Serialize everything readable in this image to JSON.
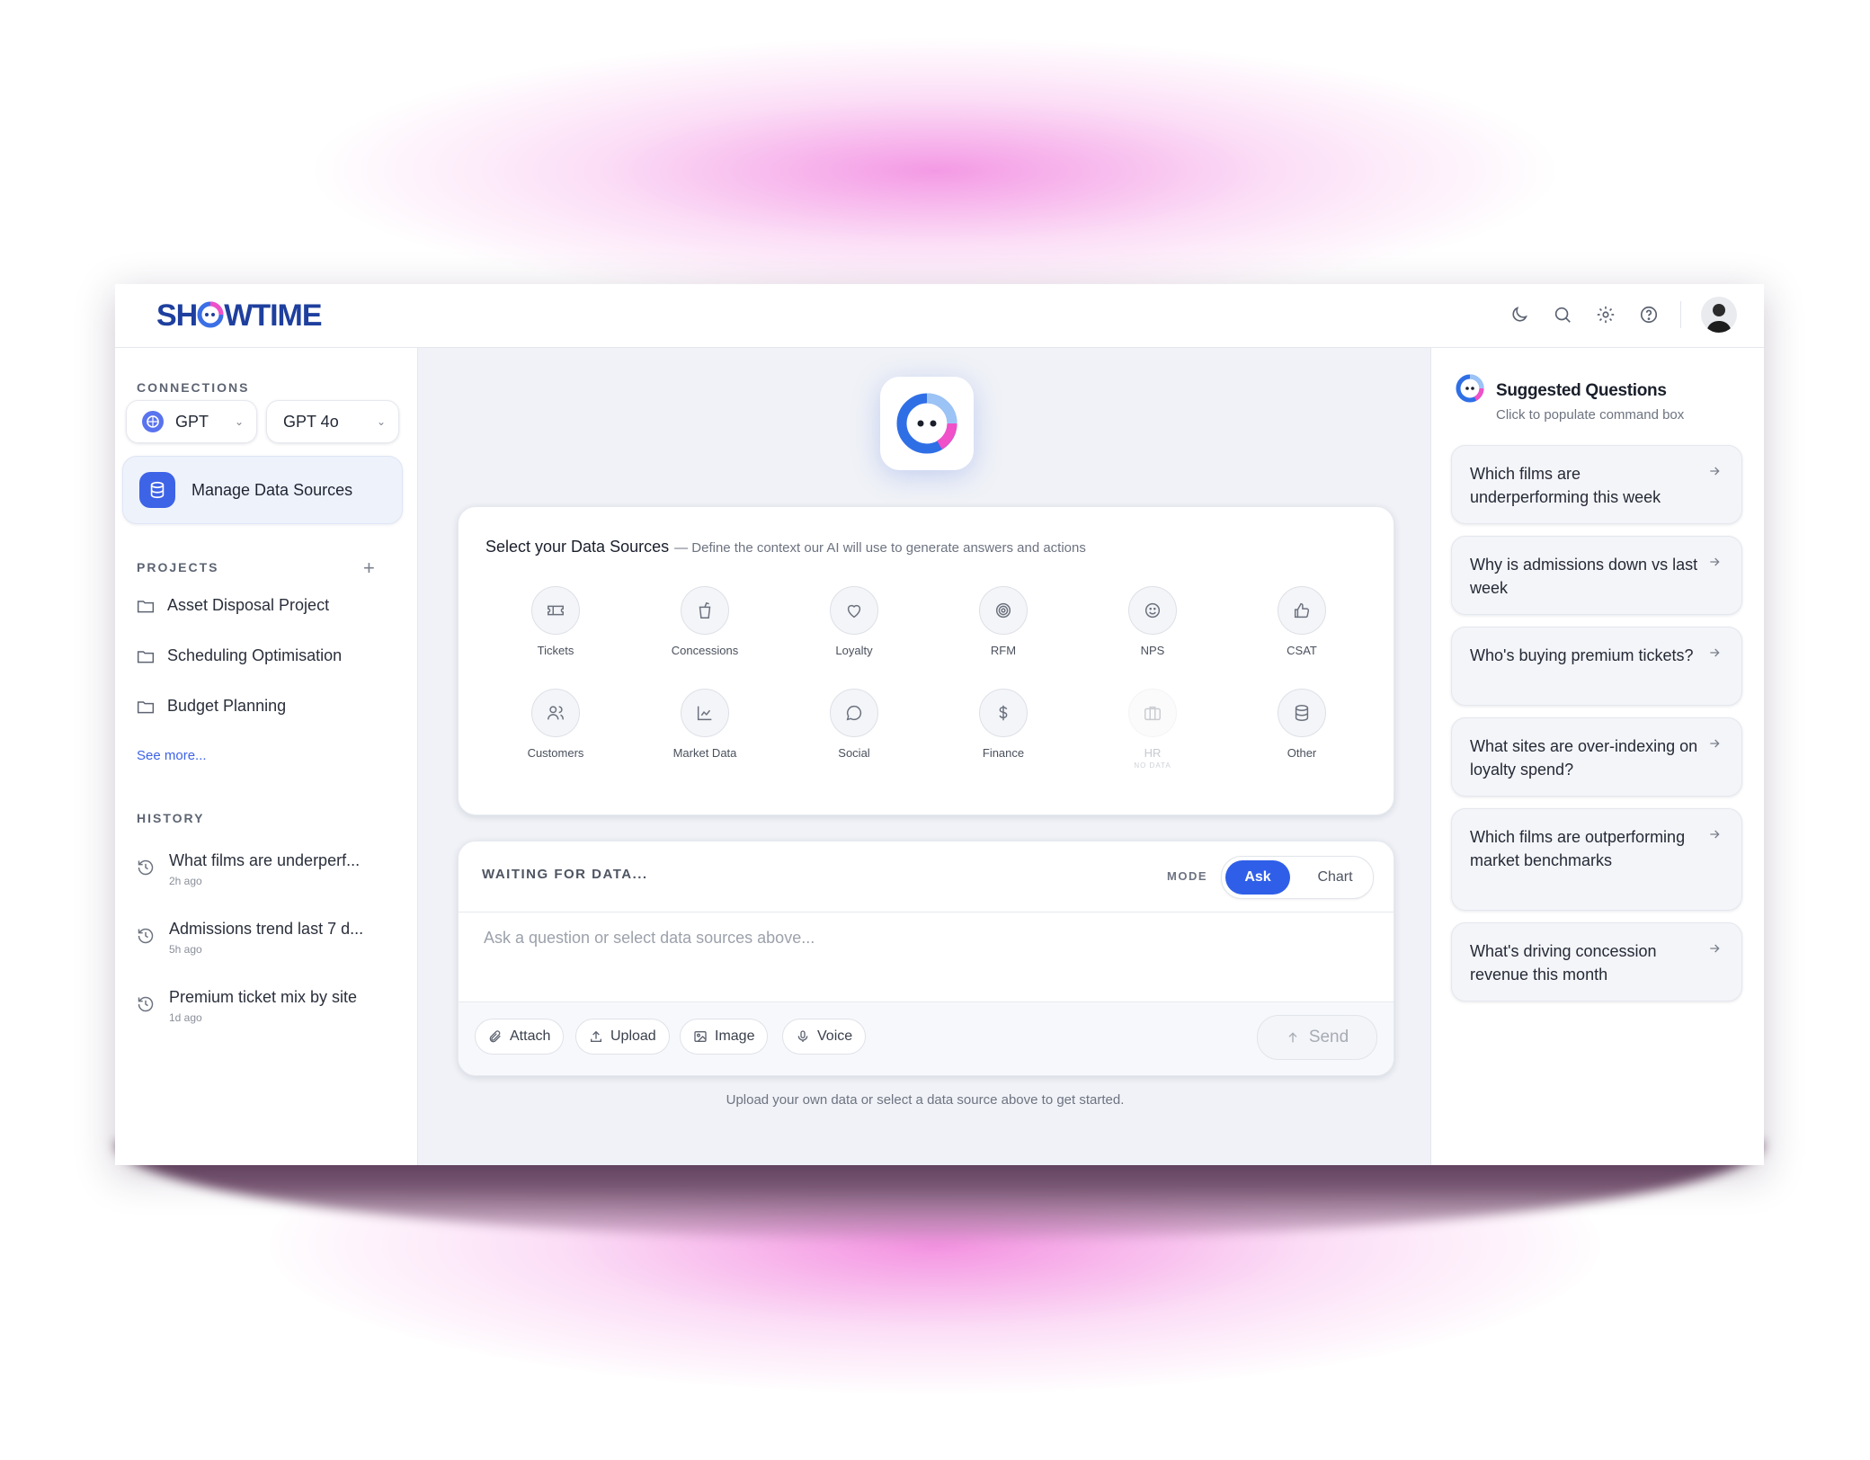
{
  "brand": {
    "logo_text_before": "SH",
    "logo_text_after": "WTIME"
  },
  "connections": {
    "label": "CONNECTIONS",
    "provider": "GPT",
    "model": "GPT 4o",
    "manage_label": "Manage Data Sources"
  },
  "projects": {
    "label": "PROJECTS",
    "items": [
      {
        "label": "Asset Disposal Project"
      },
      {
        "label": "Scheduling Optimisation"
      },
      {
        "label": "Budget Planning"
      }
    ],
    "see_more": "See more..."
  },
  "history": {
    "label": "HISTORY",
    "items": [
      {
        "title": "What films are underperf...",
        "time": "2h ago"
      },
      {
        "title": "Admissions trend last 7 d...",
        "time": "5h ago"
      },
      {
        "title": "Premium ticket mix by site",
        "time": "1d ago"
      }
    ]
  },
  "data_sources": {
    "title": "Select your Data Sources",
    "subtitle": "— Define the context our AI will use to generate answers and actions",
    "items": [
      {
        "label": "Tickets",
        "icon": "ticket-icon"
      },
      {
        "label": "Concessions",
        "icon": "drink-icon"
      },
      {
        "label": "Loyalty",
        "icon": "heart-icon"
      },
      {
        "label": "RFM",
        "icon": "target-icon"
      },
      {
        "label": "NPS",
        "icon": "smile-icon"
      },
      {
        "label": "CSAT",
        "icon": "thumbs-up-icon"
      },
      {
        "label": "Customers",
        "icon": "users-icon"
      },
      {
        "label": "Market Data",
        "icon": "line-chart-icon"
      },
      {
        "label": "Social",
        "icon": "chat-bubble-icon"
      },
      {
        "label": "Finance",
        "icon": "dollar-icon"
      },
      {
        "label": "HR",
        "icon": "briefcase-icon",
        "note": "NO DATA"
      },
      {
        "label": "Other",
        "icon": "database-icon"
      }
    ]
  },
  "command": {
    "status": "WAITING FOR DATA...",
    "mode_label": "MODE",
    "mode_ask": "Ask",
    "mode_chart": "Chart",
    "placeholder": "Ask a question or select data sources above...",
    "tools": [
      "Attach",
      "Upload",
      "Image",
      "Voice"
    ],
    "send": "Send",
    "hint": "Upload your own data or select a data source above to get started."
  },
  "suggested": {
    "title": "Suggested Questions",
    "subtitle": "Click to populate command box",
    "questions": [
      "Which films are underperforming this week",
      "Why is admissions down vs last week",
      "Who's buying premium tickets?",
      "What sites are over-indexing on loyalty spend?",
      "Which films are outperforming market benchmarks",
      "What's driving concession revenue this month"
    ]
  },
  "colors": {
    "accent": "#2f5fe8",
    "brand": "#1e3f9e",
    "pink": "#f050c8"
  }
}
